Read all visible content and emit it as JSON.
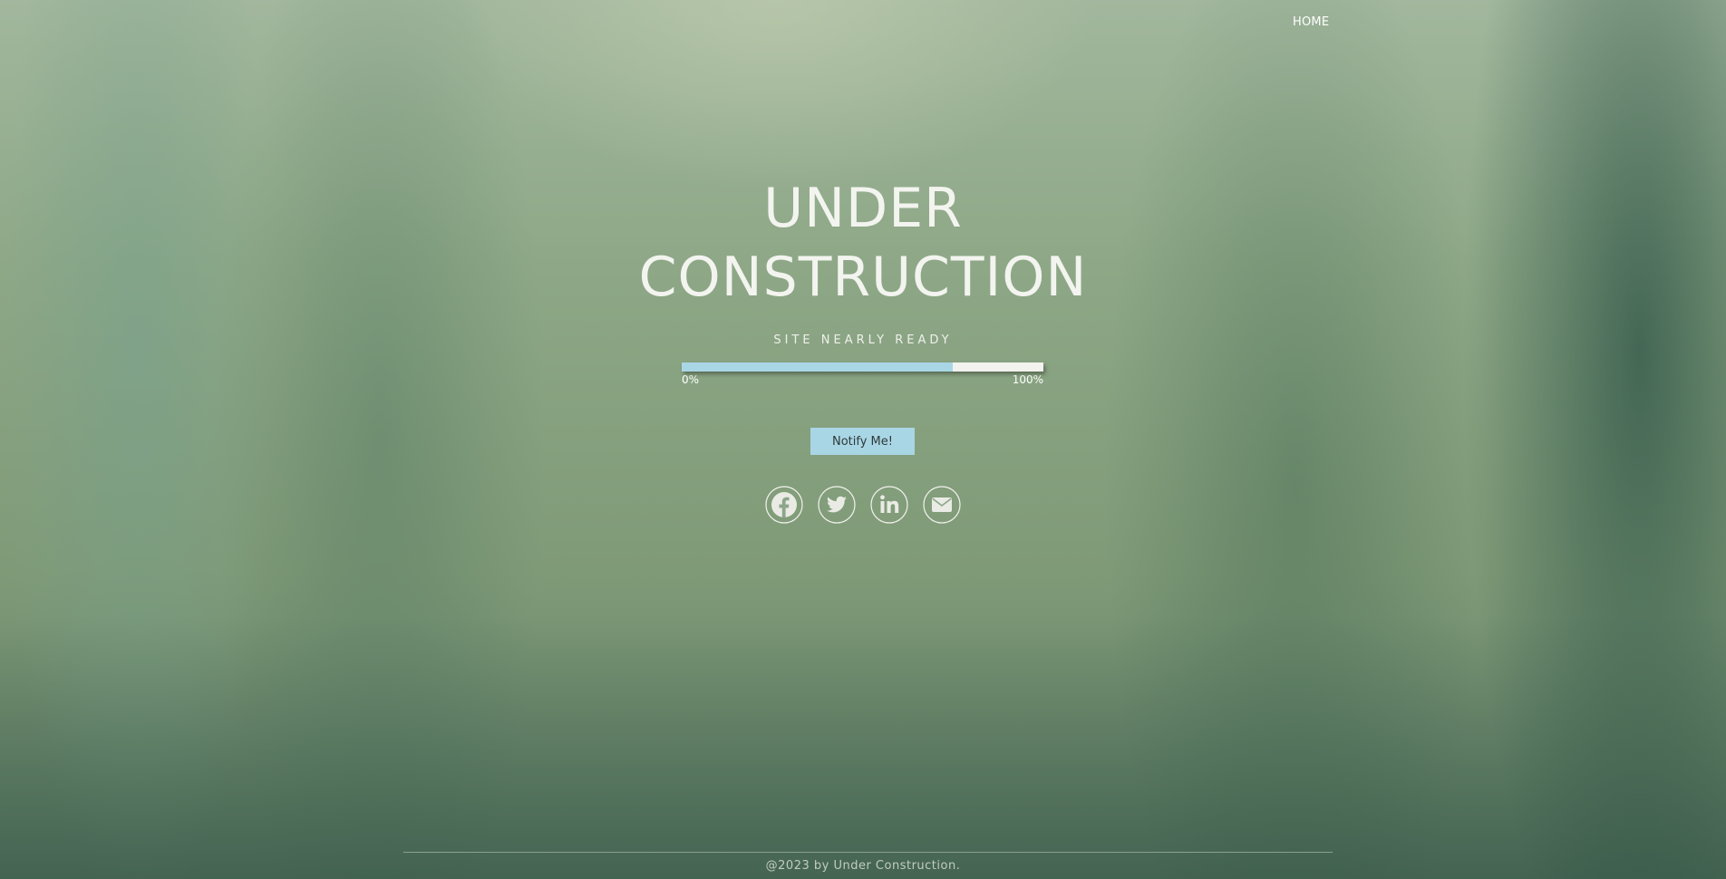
{
  "nav": {
    "home_label": "HOME"
  },
  "hero": {
    "title_line1": "UNDER",
    "title_line2": "CONSTRUCTION",
    "subtitle": "SITE NEARLY READY"
  },
  "progress": {
    "percent": 75,
    "start_label": "0%",
    "end_label": "100%",
    "fill_color": "#a9d6e5",
    "track_color": "#f2f2ee"
  },
  "notify": {
    "label": "Notify Me!"
  },
  "social": [
    {
      "icon": "facebook-icon"
    },
    {
      "icon": "twitter-icon"
    },
    {
      "icon": "linkedin-icon"
    },
    {
      "icon": "email-icon"
    }
  ],
  "footer": {
    "text": "@2023 by Under Construction."
  }
}
